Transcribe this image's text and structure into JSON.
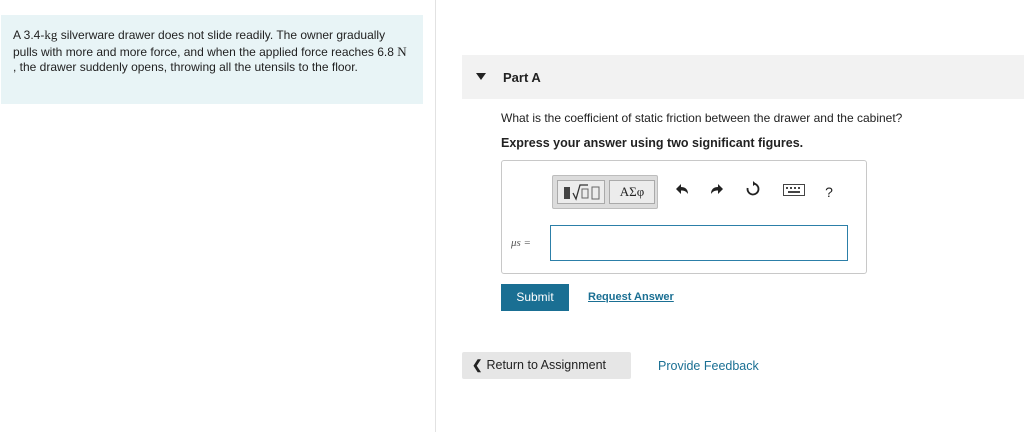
{
  "problem": {
    "text_1": "A 3.4-",
    "unit_kg": "kg",
    "text_2": " silverware drawer does not slide readily. The owner gradually pulls with more and more force, and when the applied force reaches 6.8 ",
    "unit_n": "N",
    "text_3": " , the drawer suddenly opens, throwing all the utensils to the floor."
  },
  "part": {
    "title": "Part A"
  },
  "question": "What is the coefficient of static friction between the drawer and the cabinet?",
  "instruction": "Express your answer using two significant figures.",
  "toolbar": {
    "greek_label": "ΑΣφ",
    "help_label": "?"
  },
  "answer": {
    "label": "μs =",
    "value": ""
  },
  "actions": {
    "submit": "Submit",
    "request_answer": "Request Answer",
    "return": "Return to Assignment",
    "feedback": "Provide Feedback"
  },
  "colors": {
    "accent": "#1a6f93",
    "problem_bg": "#e8f4f6",
    "header_bg": "#f2f2f2"
  }
}
